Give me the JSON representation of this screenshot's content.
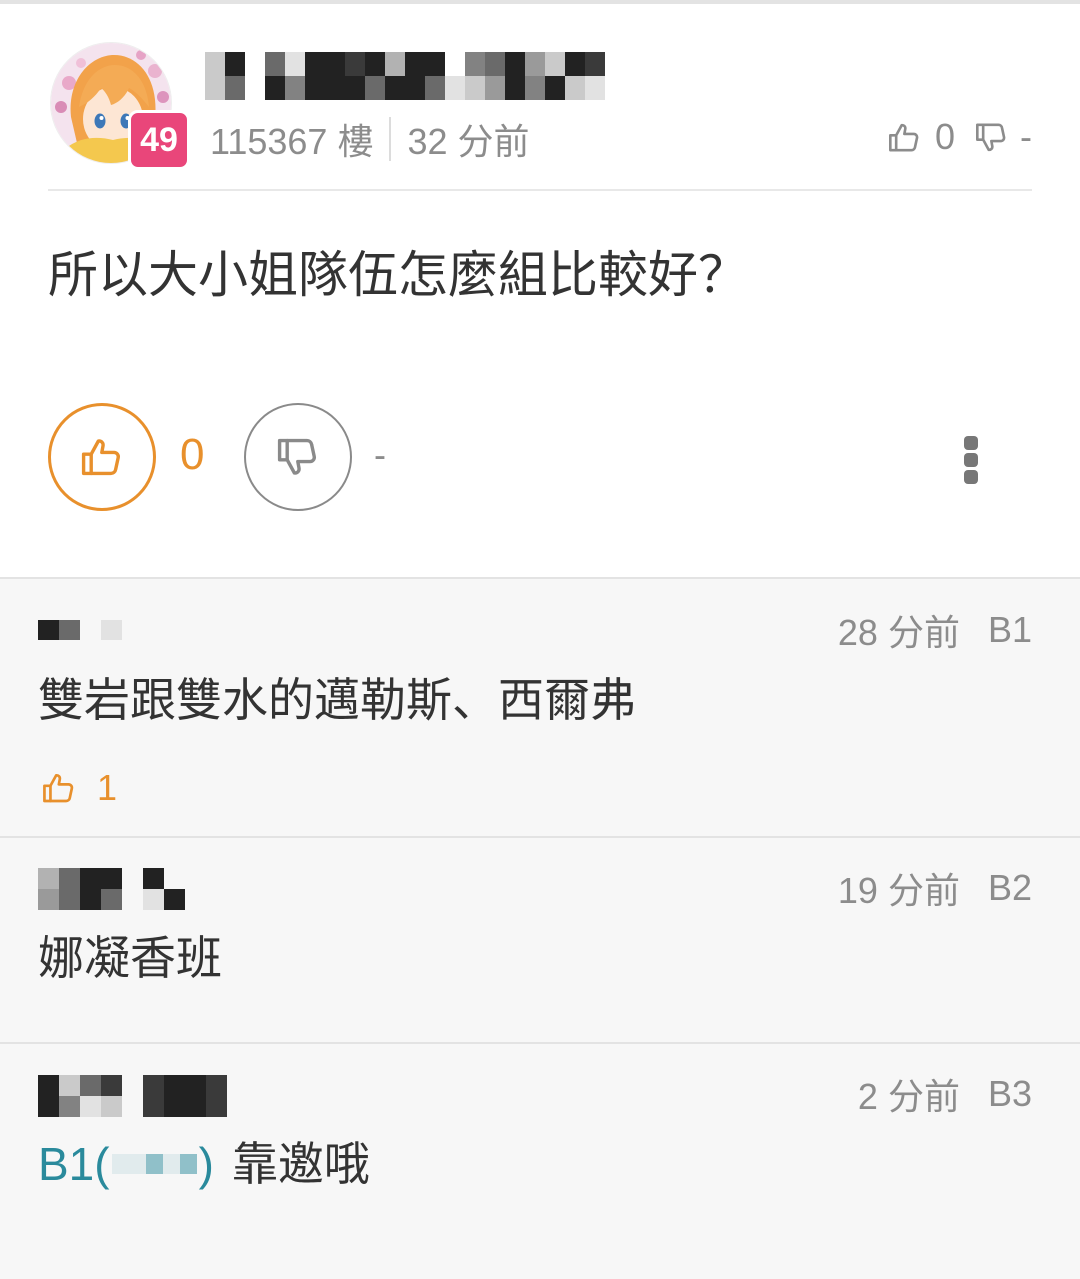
{
  "post": {
    "level": "49",
    "floor": "115367 樓",
    "time": "32 分前",
    "header_like_count": "0",
    "header_dislike_count": "-",
    "content": "所以大小姐隊伍怎麼組比較好？",
    "like_count": "0",
    "dislike_count": "-"
  },
  "comments": [
    {
      "time": "28 分前",
      "floor": "B1",
      "content": "雙岩跟雙水的邁勒斯、西爾弗",
      "like_count": "1"
    },
    {
      "time": "19 分前",
      "floor": "B2",
      "content": "娜凝香班"
    },
    {
      "time": "2 分前",
      "floor": "B3",
      "reply_prefix": "B1(",
      "reply_suffix": ")",
      "content": "靠邀哦"
    }
  ],
  "icons": {
    "like": "thumbs-up-icon",
    "dislike": "thumbs-down-icon",
    "more": "more-vertical-icon"
  },
  "colors": {
    "accent": "#e8902c",
    "reply_link": "#2a8a9c",
    "level_badge": "#e9467a",
    "text": "#333333",
    "muted": "#8c8c8c"
  }
}
